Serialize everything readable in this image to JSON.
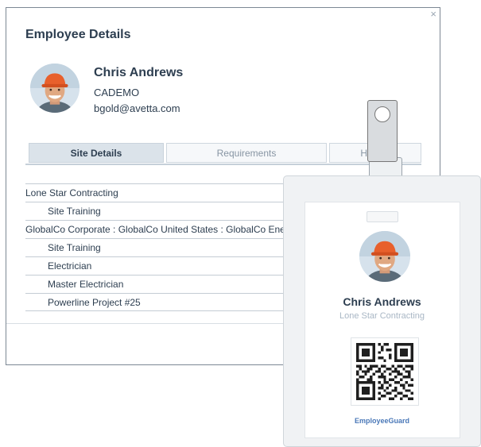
{
  "dialog": {
    "title": "Employee Details",
    "close_icon": "×",
    "employee": {
      "name": "Chris Andrews",
      "company": "CADEMO",
      "email": "bgold@avetta.com"
    },
    "tabs": [
      {
        "label": "Site Details",
        "active": true
      },
      {
        "label": "Requirements",
        "active": false
      },
      {
        "label": "History",
        "active": false
      }
    ],
    "sites": [
      {
        "label": "Lone Star Contracting",
        "indent": false
      },
      {
        "label": "Site Training",
        "indent": true
      },
      {
        "label": "GlobalCo Corporate : GlobalCo United States : GlobalCo Energy",
        "indent": false
      },
      {
        "label": "Site Training",
        "indent": true
      },
      {
        "label": "Electrician",
        "indent": true
      },
      {
        "label": "Master Electrician",
        "indent": true
      },
      {
        "label": "Powerline Project #25",
        "indent": true
      }
    ]
  },
  "badge": {
    "name": "Chris Andrews",
    "company": "Lone Star Contracting",
    "brand": "EmployeeGuard"
  },
  "colors": {
    "title": "#2d3e50",
    "tab_active_bg": "#dbe3ea",
    "brand_blue": "#4a78b8",
    "hardhat_orange": "#e8602c"
  }
}
